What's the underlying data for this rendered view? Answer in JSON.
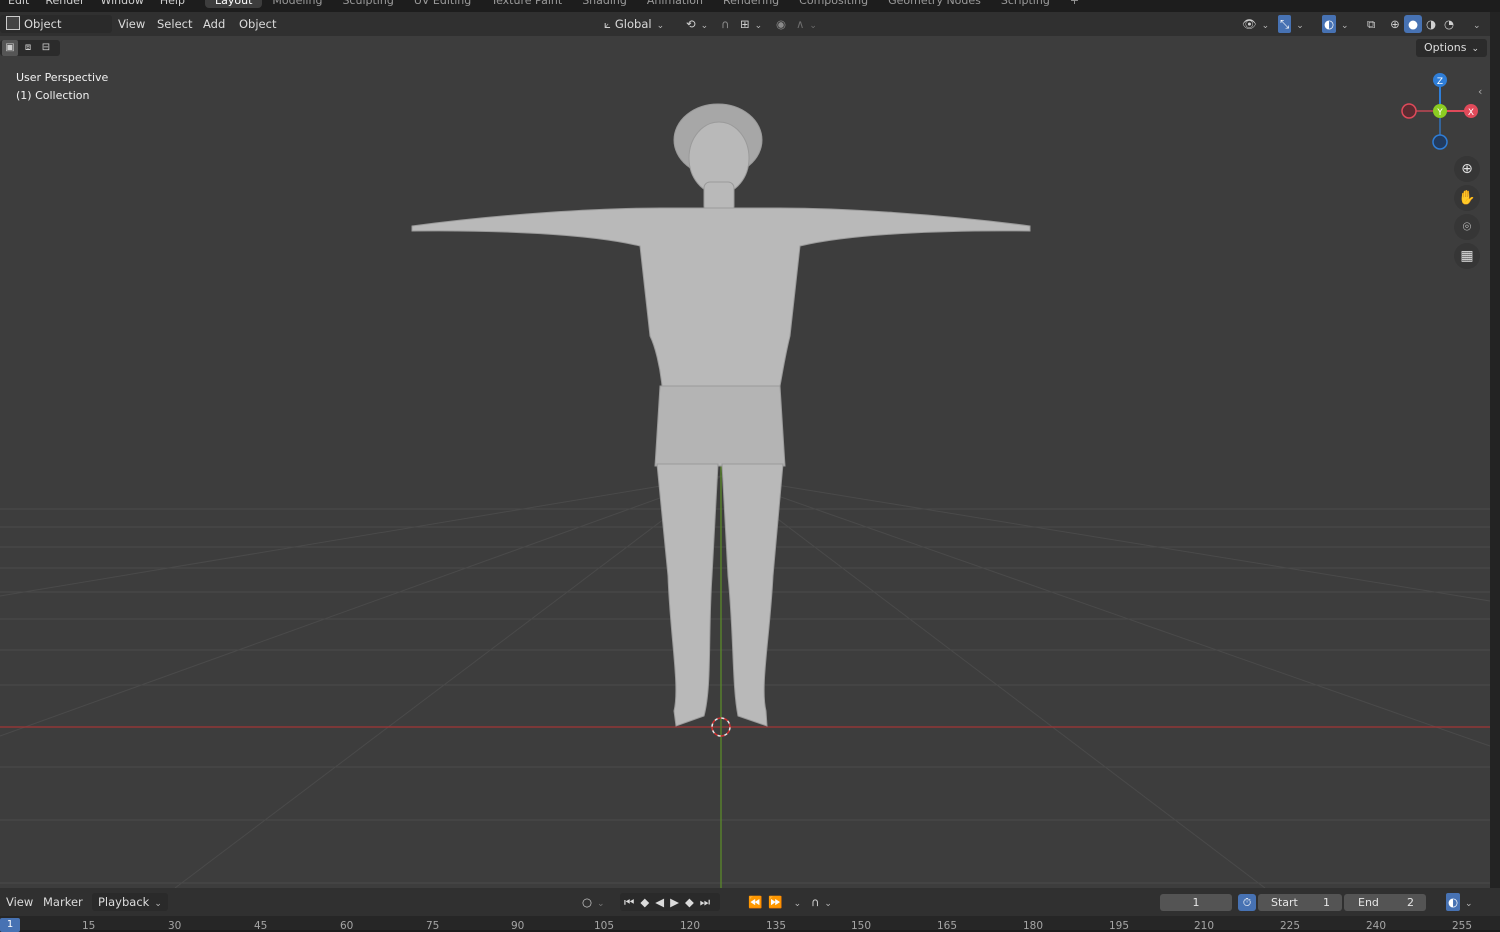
{
  "top_menu": [
    "Edit",
    "Render",
    "Window",
    "Help"
  ],
  "workspace_tabs": [
    "Layout",
    "Modeling",
    "Sculpting",
    "UV Editing",
    "Texture Paint",
    "Shading",
    "Animation",
    "Rendering",
    "Compositing",
    "Geometry Nodes",
    "Scripting",
    "+"
  ],
  "active_tab": "Layout",
  "header": {
    "mode": "Object Mode",
    "menus": [
      "View",
      "Select",
      "Add",
      "Object"
    ],
    "orientation": "Global",
    "options_label": "Options"
  },
  "viewport": {
    "perspective_label": "User Perspective",
    "collection_label": "(1) Collection",
    "background_color": "#3d3d3d",
    "gizmo": {
      "z": "Z",
      "y": "Y",
      "x": "X"
    },
    "axis_colors": {
      "x": "#e04a5a",
      "y": "#8ccc22",
      "z": "#2f7ed8"
    }
  },
  "timeline": {
    "menus": [
      "View",
      "Marker",
      "Playback"
    ],
    "current_frame": "1",
    "start_label": "Start",
    "start_value": "1",
    "end_label": "End",
    "end_value": "2",
    "ruler_frame": "1",
    "ruler": [
      "15",
      "30",
      "45",
      "60",
      "75",
      "90",
      "105",
      "120",
      "135",
      "150",
      "165",
      "180",
      "195",
      "210",
      "225",
      "240",
      "255"
    ]
  },
  "colors": {
    "accent": "#4772b3",
    "header": "#303030"
  }
}
